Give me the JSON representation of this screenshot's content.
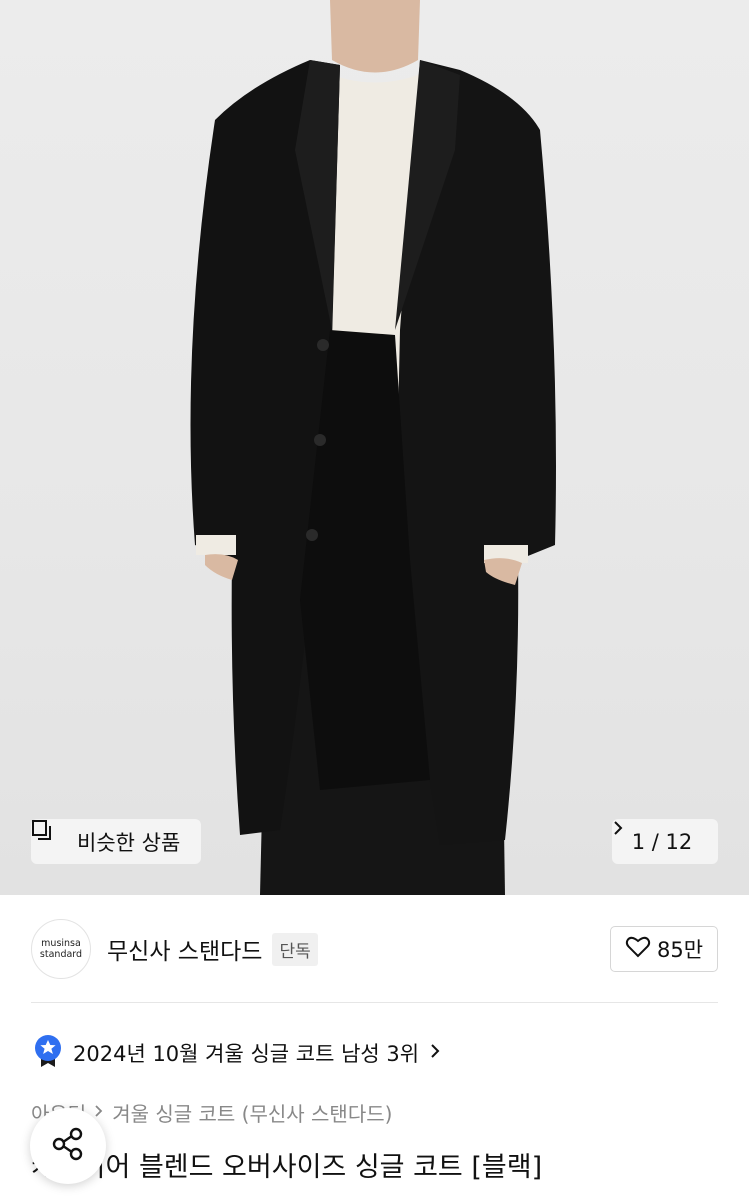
{
  "gallery": {
    "similar_label": "비슷한 상품",
    "counter": "1 / 12"
  },
  "brand": {
    "logo_line1": "musinsa",
    "logo_line2": "standard",
    "name": "무신사 스탠다드",
    "badge": "단독",
    "likes": "85만"
  },
  "ranking": {
    "text": "2024년 10월 겨울 싱글 코트 남성 3위"
  },
  "breadcrumb": {
    "item1": "아우터",
    "item2": "겨울 싱글 코트 (무신사 스탠다드)"
  },
  "product": {
    "title": "캐시미어 블렌드 오버사이즈 싱글 코트 [블랙]"
  },
  "colors": {
    "accent_blue": "#2f6ff0"
  }
}
